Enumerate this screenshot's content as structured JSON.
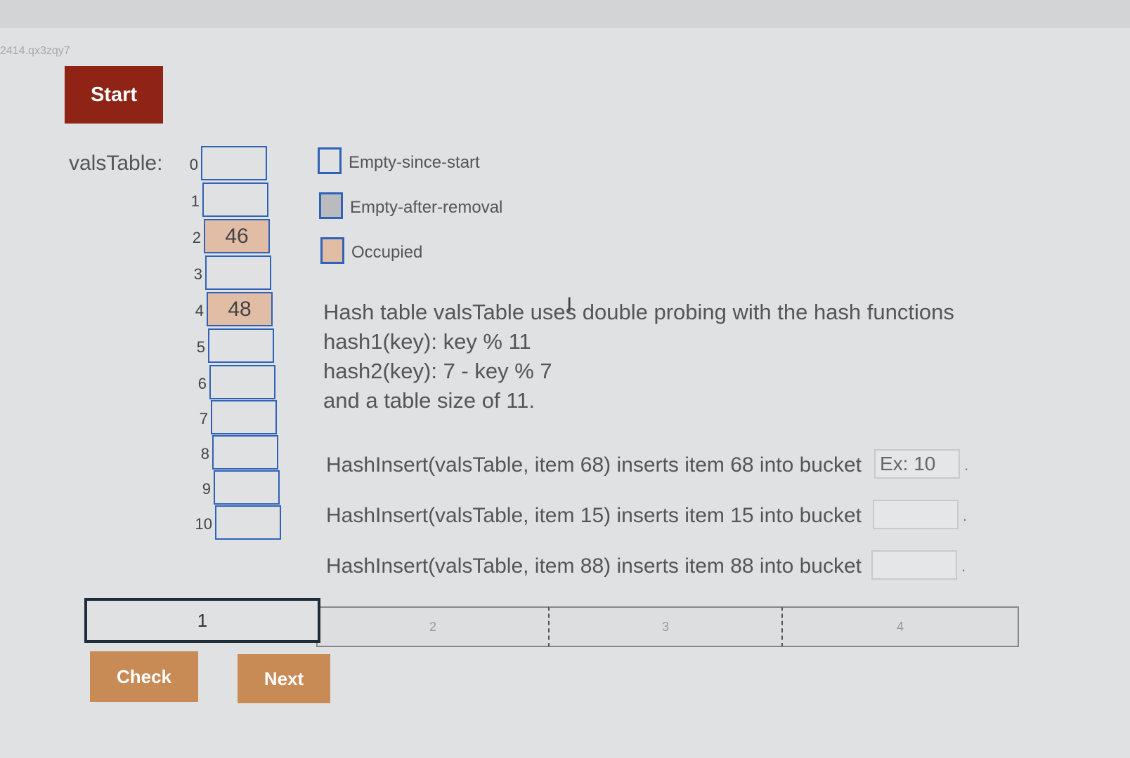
{
  "activity_id": "2414.qx3zqy7",
  "buttons": {
    "start": "Start",
    "check": "Check",
    "next": "Next"
  },
  "table": {
    "label": "valsTable:",
    "rows": [
      {
        "index": "0",
        "value": "",
        "state": "empty"
      },
      {
        "index": "1",
        "value": "",
        "state": "empty"
      },
      {
        "index": "2",
        "value": "46",
        "state": "occupied"
      },
      {
        "index": "3",
        "value": "",
        "state": "empty"
      },
      {
        "index": "4",
        "value": "48",
        "state": "occupied"
      },
      {
        "index": "5",
        "value": "",
        "state": "empty"
      },
      {
        "index": "6",
        "value": "",
        "state": "empty"
      },
      {
        "index": "7",
        "value": "",
        "state": "empty"
      },
      {
        "index": "8",
        "value": "",
        "state": "empty"
      },
      {
        "index": "9",
        "value": "",
        "state": "empty"
      },
      {
        "index": "10",
        "value": "",
        "state": "empty"
      }
    ]
  },
  "legend": [
    {
      "label": "Empty-since-start",
      "color": "#dfe1e2"
    },
    {
      "label": "Empty-after-removal",
      "color": "#b9bbbe"
    },
    {
      "label": "Occupied",
      "color": "#e2bda6"
    }
  ],
  "description": {
    "line1": "Hash table valsTable uses double probing with the hash functions",
    "line2": "hash1(key): key % 11",
    "line3": "hash2(key): 7 - key % 7",
    "line4": "and a table size of 11."
  },
  "questions": [
    {
      "text": "HashInsert(valsTable, item 68) inserts item 68 into bucket",
      "placeholder": "Ex: 10",
      "value": ""
    },
    {
      "text": "HashInsert(valsTable, item 15) inserts item 15 into bucket",
      "placeholder": "",
      "value": ""
    },
    {
      "text": "HashInsert(valsTable, item 88) inserts item 88 into bucket",
      "placeholder": "",
      "value": ""
    }
  ],
  "progress": {
    "steps": [
      "1",
      "2",
      "3",
      "4"
    ],
    "active": "1"
  },
  "colors": {
    "start": "#8e2316",
    "action": "#c98b55",
    "cell_border": "#2f62b8",
    "occupied": "#e2bda6"
  }
}
